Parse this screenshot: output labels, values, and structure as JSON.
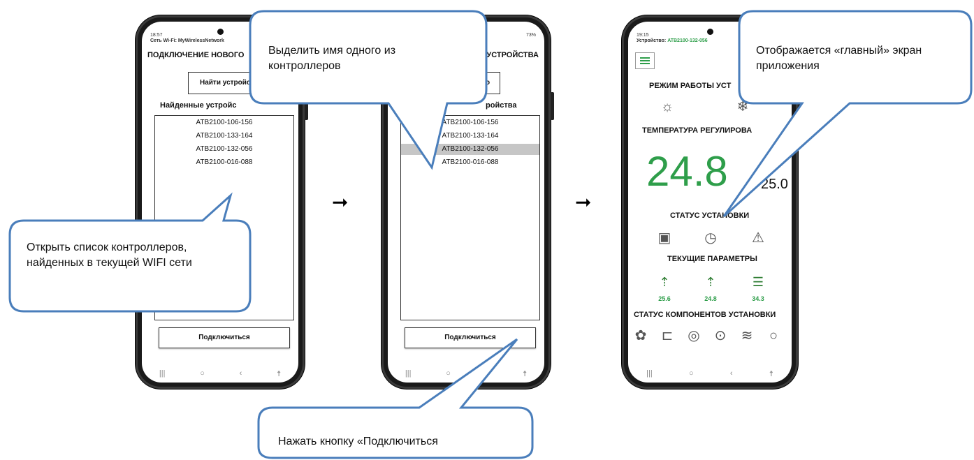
{
  "phone1": {
    "status_time": "18:57 ",
    "wifi_line": "Сеть Wi-Fi: MyWirelessNetwork",
    "title": "ПОДКЛЮЧЕНИЕ НОВОГО",
    "find_button": "Найти устройст",
    "found_header": "Найденные устройс",
    "devices": [
      "ATB2100-106-156",
      "ATB2100-133-164",
      "ATB2100-132-056",
      "ATB2100-016-088"
    ],
    "connect_button": "Подключиться"
  },
  "phone2": {
    "status_right": "73%",
    "title": "УСТРОЙСТВА",
    "find_button": "во",
    "found_header": "ройства",
    "devices": [
      "ATB2100-106-156",
      "ATB2100-133-164",
      "ATB2100-132-056",
      "ATB2100-016-088"
    ],
    "selected_index": 2,
    "connect_button": "Подключиться"
  },
  "phone3": {
    "status_time": "19:15 ",
    "device_label": "Устройство:",
    "device_id": "ATB2100-132-056",
    "mode_title": "РЕЖИМ РАБОТЫ УСТ",
    "temp_title": "ТЕМПЕРАТУРА РЕГУЛИРОВА",
    "temp_current": "24.8",
    "temp_set": "25.0",
    "status_title": "СТАТУС УСТАНОВКИ",
    "params_title": "ТЕКУЩИЕ ПАРАМЕТРЫ",
    "params": [
      "25.6",
      "24.8",
      "34.3"
    ],
    "components_title": "СТАТУС КОМПОНЕНТОВ УСТАНОВКИ",
    "accent_color": "#2e9e4a"
  },
  "callouts": {
    "open_list": "Открыть список контроллеров, найденных в текущей WIFI сети",
    "select_name": "Выделить имя одного из контроллеров",
    "press_connect": "Нажать кнопку «Подключиться",
    "main_screen": "Отображается «главный» экран приложения"
  },
  "callout_color": "#4a7ebb"
}
